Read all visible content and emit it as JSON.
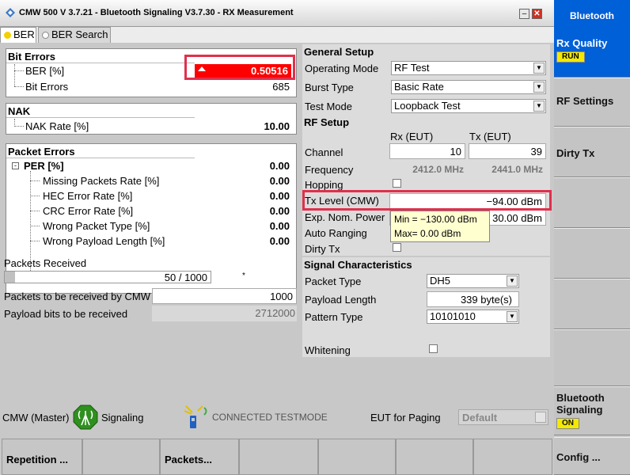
{
  "window": {
    "title": "CMW 500 V 3.7.21 - Bluetooth Signaling  V3.7.30 - RX Measurement"
  },
  "tabs": [
    {
      "label": "BER",
      "dot": "#f4d000"
    },
    {
      "label": "BER Search",
      "dot": "#ffffff"
    }
  ],
  "bit_errors": {
    "header": "Bit Errors",
    "ber_label": "BER [%]",
    "ber_value": "0.50516",
    "bit_errors_label": "Bit Errors",
    "bit_errors_value": "685"
  },
  "nak": {
    "header": "NAK",
    "rate_label": "NAK Rate [%]",
    "rate_value": "10.00"
  },
  "packet_errors": {
    "header": "Packet Errors",
    "per_label": "PER [%]",
    "per_value": "0.00",
    "rows": [
      {
        "label": "Missing Packets Rate [%]",
        "value": "0.00"
      },
      {
        "label": "HEC Error Rate [%]",
        "value": "0.00"
      },
      {
        "label": "CRC Error Rate [%]",
        "value": "0.00"
      },
      {
        "label": "Wrong Packet Type [%]",
        "value": "0.00"
      },
      {
        "label": "Wrong Payload Length [%]",
        "value": "0.00"
      }
    ]
  },
  "packets": {
    "received_label": "Packets Received",
    "received_text": "50 / 1000",
    "received_fraction": 0.05,
    "marker": "*",
    "to_receive_label": "Packets to be received by CMW",
    "to_receive_value": "1000",
    "payload_label": "Payload bits to be received",
    "payload_value": "2712000"
  },
  "general_setup": {
    "header": "General Setup",
    "operating_mode_label": "Operating Mode",
    "operating_mode": "RF Test",
    "burst_type_label": "Burst Type",
    "burst_type": "Basic Rate",
    "test_mode_label": "Test Mode",
    "test_mode": "Loopback Test"
  },
  "rf_setup": {
    "header": "RF Setup",
    "rx_header": "Rx (EUT)",
    "tx_header": "Tx (EUT)",
    "channel_label": "Channel",
    "channel_rx": "10",
    "channel_tx": "39",
    "frequency_label": "Frequency",
    "frequency_rx": "2412.0 MHz",
    "frequency_tx": "2441.0 MHz",
    "hopping_label": "Hopping",
    "tx_level_label": "Tx Level (CMW)",
    "tx_level_value": "−94.00  dBm",
    "exp_power_label": "Exp. Nom. Power",
    "exp_power_value": "30.00  dBm",
    "auto_ranging_label": "Auto Ranging",
    "dirty_tx_label": "Dirty Tx",
    "tooltip_min": "Min = −130.00 dBm",
    "tooltip_max": "Max= 0.00 dBm"
  },
  "signal": {
    "header": "Signal Characteristics",
    "packet_type_label": "Packet Type",
    "packet_type": "DH5",
    "payload_length_label": "Payload Length",
    "payload_length": "339  byte(s)",
    "pattern_type_label": "Pattern Type",
    "pattern_type": "10101010",
    "whitening_label": "Whitening"
  },
  "status": {
    "master_label": "CMW (Master)",
    "signaling_label": "Signaling",
    "connected_label": "CONNECTED TESTMODE",
    "eut_paging_label": "EUT for Paging",
    "eut_paging_value": "Default"
  },
  "sidebar": {
    "header": "Bluetooth",
    "rx_quality": "Rx Quality",
    "rx_quality_badge": "RUN",
    "rf_settings": "RF Settings",
    "dirty_tx": "Dirty Tx",
    "bt_signaling": "Bluetooth Signaling",
    "bt_signaling_badge": "ON",
    "config": "Config ..."
  },
  "bottom": {
    "repetition": "Repetition ...",
    "packets": "Packets..."
  },
  "colors": {
    "accent": "#0060d8",
    "alarm": "#ff0000",
    "highlight_box": "#e0304c",
    "badge": "#f4e900"
  }
}
